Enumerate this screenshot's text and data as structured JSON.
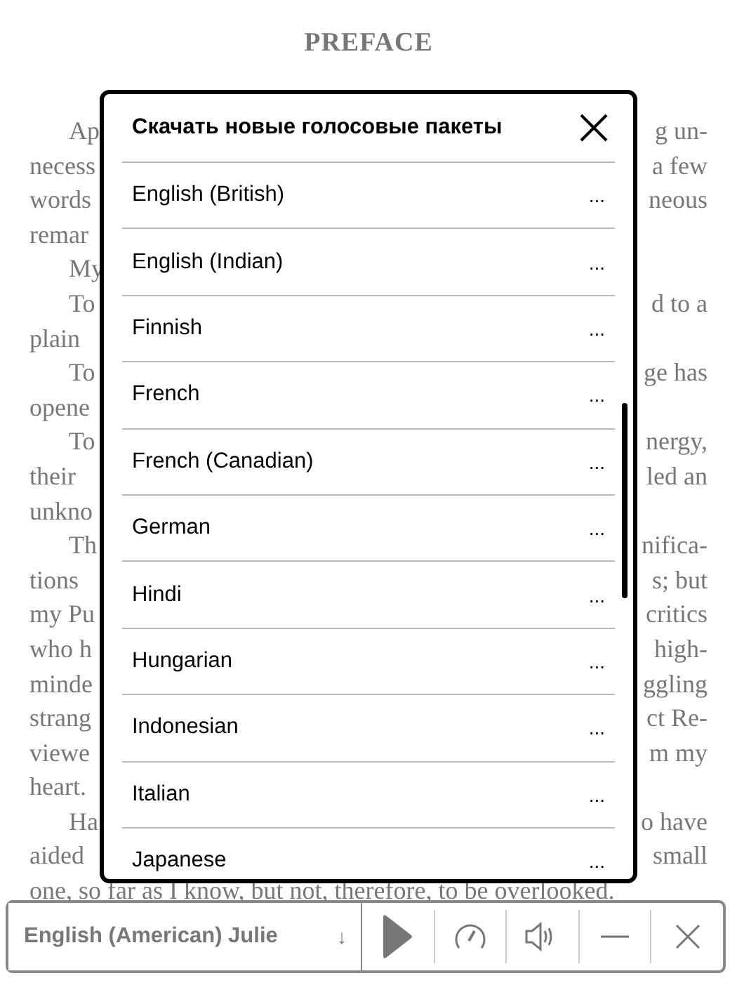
{
  "page": {
    "title": "PREFACE",
    "lines": [
      {
        "kind": "indent",
        "left": "Ap",
        "right": "g un-"
      },
      {
        "kind": "plain",
        "left": "necess",
        "right": "a few"
      },
      {
        "kind": "plain",
        "left": "words",
        "right": "neous"
      },
      {
        "kind": "plain",
        "left": "remar"
      },
      {
        "kind": "indent",
        "left": "My"
      },
      {
        "kind": "indent",
        "left": "To",
        "right": "d to a"
      },
      {
        "kind": "plain",
        "left": "plain"
      },
      {
        "kind": "indent",
        "left": "To",
        "right": "ge has"
      },
      {
        "kind": "plain",
        "left": "opene"
      },
      {
        "kind": "indent",
        "left": "To",
        "right": "nergy,"
      },
      {
        "kind": "plain",
        "left": "their",
        "right": "led an"
      },
      {
        "kind": "plain",
        "left": "unkno"
      },
      {
        "kind": "indent",
        "left": "Th",
        "right": "nifica-"
      },
      {
        "kind": "plain",
        "left": "tions",
        "right": "s; but"
      },
      {
        "kind": "plain",
        "left": "my Pu",
        "right": "critics"
      },
      {
        "kind": "plain",
        "left": "who h",
        "right": "high-"
      },
      {
        "kind": "plain",
        "left": "minde",
        "right": "ggling"
      },
      {
        "kind": "plain",
        "left": "strang",
        "right": "ct Re-"
      },
      {
        "kind": "plain",
        "left": "viewe",
        "right": "m my"
      },
      {
        "kind": "plain",
        "left": "heart."
      },
      {
        "kind": "indent",
        "left": "Ha",
        "right": "o have"
      },
      {
        "kind": "plain",
        "left": "aided",
        "right": "small"
      },
      {
        "kind": "full",
        "left": "one, so far as I know, but not, therefore, to be overlooked."
      }
    ]
  },
  "dialog": {
    "title": "Скачать новые голосовые пакеты",
    "items": [
      {
        "label": "English (British)",
        "action": "..."
      },
      {
        "label": "English (Indian)",
        "action": "..."
      },
      {
        "label": "Finnish",
        "action": "..."
      },
      {
        "label": "French",
        "action": "..."
      },
      {
        "label": "French (Canadian)",
        "action": "..."
      },
      {
        "label": "German",
        "action": "..."
      },
      {
        "label": "Hindi",
        "action": "..."
      },
      {
        "label": "Hungarian",
        "action": "..."
      },
      {
        "label": "Indonesian",
        "action": "..."
      },
      {
        "label": "Italian",
        "action": "..."
      },
      {
        "label": "Japanese",
        "action": "..."
      }
    ]
  },
  "toolbar": {
    "voice": "English (American) Julie",
    "dropdown": "↓"
  }
}
